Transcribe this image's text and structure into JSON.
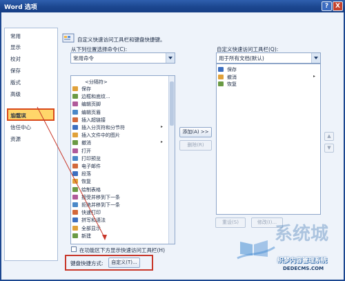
{
  "window": {
    "title": "Word 选项",
    "help": "?",
    "close": "X"
  },
  "nav": {
    "items": [
      "常用",
      "显示",
      "校对",
      "保存",
      "版式",
      "高级",
      "自定义",
      "加载项",
      "信任中心",
      "资源"
    ],
    "selected": "自定义"
  },
  "header": "自定义快速访问工具栏和键盘快捷键。",
  "left": {
    "label": "从下列位置选择命令(C):",
    "value": "常用命令",
    "items": [
      {
        "label": "<分隔符>",
        "icon": "separator"
      },
      {
        "label": "保存",
        "icon": "save-icon"
      },
      {
        "label": "边框和底纹...",
        "icon": "border-icon"
      },
      {
        "label": "编辑页脚",
        "icon": "footer-icon"
      },
      {
        "label": "编辑页眉",
        "icon": "header-icon"
      },
      {
        "label": "插入超链接",
        "icon": "hyperlink-icon"
      },
      {
        "label": "插入分页符和分节符",
        "icon": "page-break-icon",
        "submenu": true
      },
      {
        "label": "插入文件中的图片",
        "icon": "picture-icon"
      },
      {
        "label": "撤消",
        "icon": "undo-icon",
        "submenu": true
      },
      {
        "label": "打开",
        "icon": "open-icon"
      },
      {
        "label": "打印预览",
        "icon": "print-preview-icon"
      },
      {
        "label": "电子邮件",
        "icon": "email-icon"
      },
      {
        "label": "段落",
        "icon": "paragraph-icon"
      },
      {
        "label": "恢复",
        "icon": "redo-icon"
      },
      {
        "label": "绘制表格",
        "icon": "draw-table-icon"
      },
      {
        "label": "接受并移到下一条",
        "icon": "accept-icon"
      },
      {
        "label": "拒绝并移到下一条",
        "icon": "reject-icon"
      },
      {
        "label": "快速打印",
        "icon": "quick-print-icon"
      },
      {
        "label": "拼写和语法",
        "icon": "spelling-icon"
      },
      {
        "label": "全部显示",
        "icon": "show-all-icon"
      },
      {
        "label": "新建",
        "icon": "new-icon"
      }
    ]
  },
  "right": {
    "label": "自定义快速访问工具栏(Q):",
    "value": "用于所有文档(默认)",
    "items": [
      {
        "label": "保存",
        "icon": "save-icon"
      },
      {
        "label": "撤消",
        "icon": "undo-icon",
        "submenu": true
      },
      {
        "label": "恢复",
        "icon": "redo-icon"
      }
    ]
  },
  "buttons": {
    "add": "添加(A) >>",
    "remove": "删除(R)",
    "reset": "重设(S)",
    "modify": "修改(I)...",
    "customize": "自定义(T)..."
  },
  "checkbox_label": "在功能区下方显示快速访问工具栏(H)",
  "shortcut_label": "键盘快捷方式:",
  "watermark": {
    "big": "系统城",
    "sub": "织梦内容管理系统",
    "url": "DEDECMS.COM"
  },
  "colors": {
    "titlebar": "#1c4790",
    "selection": "#ffd66a",
    "annotation_red": "#c8372a"
  }
}
